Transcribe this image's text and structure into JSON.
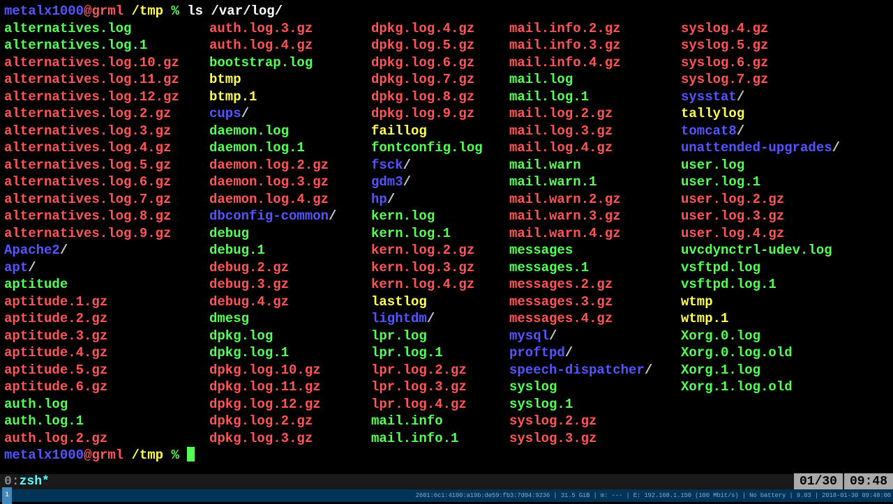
{
  "prompt": {
    "user": "metalx1000",
    "at": "@",
    "host": "grml",
    "path": "/tmp",
    "symbol": "%",
    "command": "ls /var/log/"
  },
  "columns": [
    [
      {
        "name": "alternatives.log",
        "color": "green"
      },
      {
        "name": "alternatives.log.1",
        "color": "green"
      },
      {
        "name": "alternatives.log.10.gz",
        "color": "red"
      },
      {
        "name": "alternatives.log.11.gz",
        "color": "red"
      },
      {
        "name": "alternatives.log.12.gz",
        "color": "red"
      },
      {
        "name": "alternatives.log.2.gz",
        "color": "red"
      },
      {
        "name": "alternatives.log.3.gz",
        "color": "red"
      },
      {
        "name": "alternatives.log.4.gz",
        "color": "red"
      },
      {
        "name": "alternatives.log.5.gz",
        "color": "red"
      },
      {
        "name": "alternatives.log.6.gz",
        "color": "red"
      },
      {
        "name": "alternatives.log.7.gz",
        "color": "red"
      },
      {
        "name": "alternatives.log.8.gz",
        "color": "red"
      },
      {
        "name": "alternatives.log.9.gz",
        "color": "red"
      },
      {
        "name": "Apache2",
        "color": "blue",
        "dir": true
      },
      {
        "name": "apt",
        "color": "blue",
        "dir": true
      },
      {
        "name": "aptitude",
        "color": "green"
      },
      {
        "name": "aptitude.1.gz",
        "color": "red"
      },
      {
        "name": "aptitude.2.gz",
        "color": "red"
      },
      {
        "name": "aptitude.3.gz",
        "color": "red"
      },
      {
        "name": "aptitude.4.gz",
        "color": "red"
      },
      {
        "name": "aptitude.5.gz",
        "color": "red"
      },
      {
        "name": "aptitude.6.gz",
        "color": "red"
      }
    ],
    [
      {
        "name": "auth.log.3.gz",
        "color": "red"
      },
      {
        "name": "auth.log.4.gz",
        "color": "red"
      },
      {
        "name": "bootstrap.log",
        "color": "green"
      },
      {
        "name": "btmp",
        "color": "yellow"
      },
      {
        "name": "btmp.1",
        "color": "yellow"
      },
      {
        "name": "cups",
        "color": "blue",
        "dir": true
      },
      {
        "name": "daemon.log",
        "color": "green"
      },
      {
        "name": "daemon.log.1",
        "color": "green"
      },
      {
        "name": "daemon.log.2.gz",
        "color": "red"
      },
      {
        "name": "daemon.log.3.gz",
        "color": "red"
      },
      {
        "name": "daemon.log.4.gz",
        "color": "red"
      },
      {
        "name": "dbconfig-common",
        "color": "blue",
        "dir": true
      },
      {
        "name": "debug",
        "color": "green"
      },
      {
        "name": "debug.1",
        "color": "green"
      },
      {
        "name": "debug.2.gz",
        "color": "red"
      },
      {
        "name": "debug.3.gz",
        "color": "red"
      },
      {
        "name": "debug.4.gz",
        "color": "red"
      },
      {
        "name": "dmesg",
        "color": "green"
      },
      {
        "name": "dpkg.log",
        "color": "green"
      },
      {
        "name": "dpkg.log.1",
        "color": "green"
      },
      {
        "name": "dpkg.log.10.gz",
        "color": "red"
      },
      {
        "name": "dpkg.log.11.gz",
        "color": "red"
      }
    ],
    [
      {
        "name": "dpkg.log.4.gz",
        "color": "red"
      },
      {
        "name": "dpkg.log.5.gz",
        "color": "red"
      },
      {
        "name": "dpkg.log.6.gz",
        "color": "red"
      },
      {
        "name": "dpkg.log.7.gz",
        "color": "red"
      },
      {
        "name": "dpkg.log.8.gz",
        "color": "red"
      },
      {
        "name": "dpkg.log.9.gz",
        "color": "red"
      },
      {
        "name": "faillog",
        "color": "yellow"
      },
      {
        "name": "fontconfig.log",
        "color": "green"
      },
      {
        "name": "fsck",
        "color": "blue",
        "dir": true
      },
      {
        "name": "gdm3",
        "color": "blue",
        "dir": true
      },
      {
        "name": "hp",
        "color": "blue",
        "dir": true
      },
      {
        "name": "kern.log",
        "color": "green"
      },
      {
        "name": "kern.log.1",
        "color": "green"
      },
      {
        "name": "kern.log.2.gz",
        "color": "red"
      },
      {
        "name": "kern.log.3.gz",
        "color": "red"
      },
      {
        "name": "kern.log.4.gz",
        "color": "red"
      },
      {
        "name": "lastlog",
        "color": "yellow"
      },
      {
        "name": "lightdm",
        "color": "blue",
        "dir": true
      },
      {
        "name": "lpr.log",
        "color": "green"
      },
      {
        "name": "lpr.log.1",
        "color": "green"
      },
      {
        "name": "lpr.log.2.gz",
        "color": "red"
      },
      {
        "name": "lpr.log.3.gz",
        "color": "red"
      }
    ],
    [
      {
        "name": "mail.info.2.gz",
        "color": "red"
      },
      {
        "name": "mail.info.3.gz",
        "color": "red"
      },
      {
        "name": "mail.info.4.gz",
        "color": "red"
      },
      {
        "name": "mail.log",
        "color": "green"
      },
      {
        "name": "mail.log.1",
        "color": "green"
      },
      {
        "name": "mail.log.2.gz",
        "color": "red"
      },
      {
        "name": "mail.log.3.gz",
        "color": "red"
      },
      {
        "name": "mail.log.4.gz",
        "color": "red"
      },
      {
        "name": "mail.warn",
        "color": "green"
      },
      {
        "name": "mail.warn.1",
        "color": "green"
      },
      {
        "name": "mail.warn.2.gz",
        "color": "red"
      },
      {
        "name": "mail.warn.3.gz",
        "color": "red"
      },
      {
        "name": "mail.warn.4.gz",
        "color": "red"
      },
      {
        "name": "messages",
        "color": "green"
      },
      {
        "name": "messages.1",
        "color": "green"
      },
      {
        "name": "messages.2.gz",
        "color": "red"
      },
      {
        "name": "messages.3.gz",
        "color": "red"
      },
      {
        "name": "messages.4.gz",
        "color": "red"
      },
      {
        "name": "mysql",
        "color": "blue",
        "dir": true
      },
      {
        "name": "proftpd",
        "color": "blue",
        "dir": true
      },
      {
        "name": "speech-dispatcher",
        "color": "blue",
        "dir": true
      },
      {
        "name": "syslog",
        "color": "green"
      }
    ],
    [
      {
        "name": "syslog.4.gz",
        "color": "red"
      },
      {
        "name": "syslog.5.gz",
        "color": "red"
      },
      {
        "name": "syslog.6.gz",
        "color": "red"
      },
      {
        "name": "syslog.7.gz",
        "color": "red"
      },
      {
        "name": "sysstat",
        "color": "blue",
        "dir": true
      },
      {
        "name": "tallylog",
        "color": "yellow"
      },
      {
        "name": "tomcat8",
        "color": "blue",
        "dir": true
      },
      {
        "name": "unattended-upgrades",
        "color": "blue",
        "dir": true
      },
      {
        "name": "user.log",
        "color": "green"
      },
      {
        "name": "user.log.1",
        "color": "green"
      },
      {
        "name": "user.log.2.gz",
        "color": "red"
      },
      {
        "name": "user.log.3.gz",
        "color": "red"
      },
      {
        "name": "user.log.4.gz",
        "color": "red"
      },
      {
        "name": "uvcdynctrl-udev.log",
        "color": "green"
      },
      {
        "name": "vsftpd.log",
        "color": "green"
      },
      {
        "name": "vsftpd.log.1",
        "color": "green"
      },
      {
        "name": "wtmp",
        "color": "yellow"
      },
      {
        "name": "wtmp.1",
        "color": "yellow"
      },
      {
        "name": "Xorg.0.log",
        "color": "green"
      },
      {
        "name": "Xorg.0.log.old",
        "color": "green"
      },
      {
        "name": "Xorg.1.log",
        "color": "green"
      },
      {
        "name": "Xorg.1.log.old",
        "color": "green"
      }
    ]
  ],
  "extra_lines": [
    {
      "col": 0,
      "items": [
        {
          "name": "auth.log",
          "color": "green"
        },
        {
          "name": "auth.log.1",
          "color": "green"
        },
        {
          "name": "auth.log.2.gz",
          "color": "red"
        }
      ]
    },
    {
      "col": 1,
      "items": [
        {
          "name": "dpkg.log.12.gz",
          "color": "red"
        },
        {
          "name": "dpkg.log.2.gz",
          "color": "red"
        },
        {
          "name": "dpkg.log.3.gz",
          "color": "red"
        }
      ]
    },
    {
      "col": 2,
      "items": [
        {
          "name": "lpr.log.4.gz",
          "color": "red"
        },
        {
          "name": "mail.info",
          "color": "green"
        },
        {
          "name": "mail.info.1",
          "color": "green"
        }
      ]
    },
    {
      "col": 3,
      "items": [
        {
          "name": "syslog.1",
          "color": "green"
        },
        {
          "name": "syslog.2.gz",
          "color": "red"
        },
        {
          "name": "syslog.3.gz",
          "color": "red"
        }
      ]
    }
  ],
  "status": {
    "index": "0:",
    "name": "zsh*",
    "date": "01/30",
    "time": "09:48"
  },
  "bottom": {
    "workspace": "1",
    "rest": "2601:6c1:4100:a19b:de59:fb3:7d04:9236 | 31.5 GiB | m: --- | E: 192.168.1.150 (100 Mbit/s) | No battery | 9.03 | 2018-01-30 09:48:00"
  }
}
